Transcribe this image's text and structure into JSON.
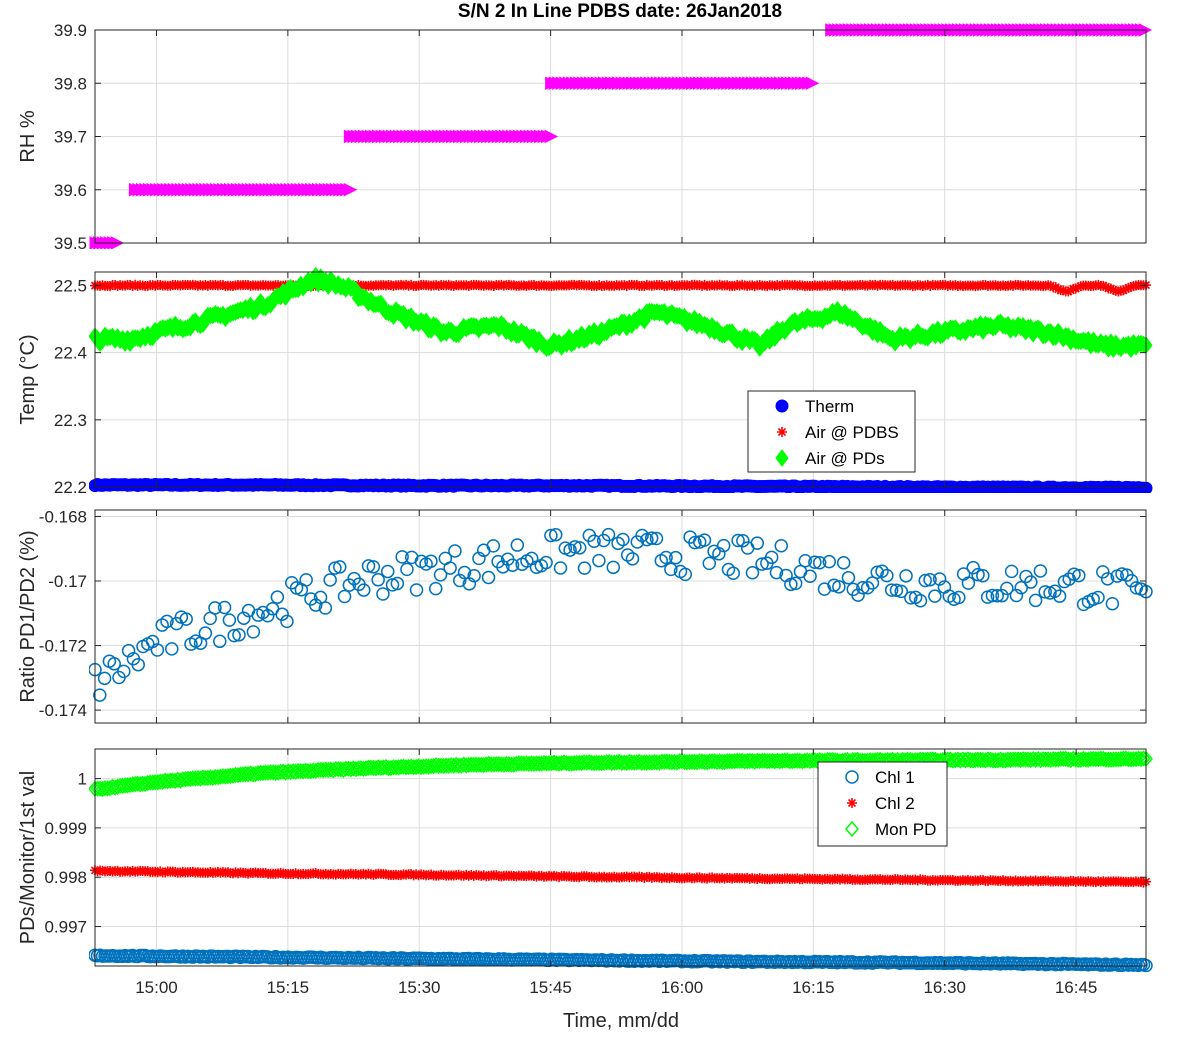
{
  "figure": {
    "title": "S/N 2 In Line PDBS date: 26Jan2018",
    "xlabel": "Time, mm/dd"
  },
  "chart_data": [
    {
      "type": "scatter",
      "ylabel": "RH %",
      "xlim": [
        14.883,
        16.883
      ],
      "ylim": [
        39.5,
        39.9
      ],
      "xticks": [
        15.0,
        15.25,
        15.5,
        15.75,
        16.0,
        16.25,
        16.5,
        16.75
      ],
      "xticklabels": [
        "15:00",
        "15:15",
        "15:30",
        "15:45",
        "16:00",
        "16:15",
        "16:30",
        "16:45"
      ],
      "yticks": [
        39.5,
        39.6,
        39.7,
        39.8,
        39.9
      ],
      "yticklabels": [
        "39.5",
        "39.6",
        "39.7",
        "39.8",
        "39.9"
      ],
      "grid": true,
      "series": [
        {
          "marker": "triangle-right",
          "color": "#ff00ff",
          "segments": [
            {
              "y": 39.5,
              "x": [
                14.883,
                14.925
              ]
            },
            {
              "y": 39.6,
              "x": [
                14.958,
                15.367
              ]
            },
            {
              "y": 39.7,
              "x": [
                15.367,
                15.75
              ]
            },
            {
              "y": 39.8,
              "x": [
                15.75,
                16.25
              ]
            },
            {
              "y": 39.9,
              "x": [
                16.283,
                16.883
              ]
            }
          ]
        }
      ]
    },
    {
      "type": "scatter",
      "ylabel": "Temp (°C)",
      "xlim": [
        14.883,
        16.883
      ],
      "ylim": [
        22.2,
        22.52
      ],
      "xticks": [
        15.0,
        15.25,
        15.5,
        15.75,
        16.0,
        16.25,
        16.5,
        16.75
      ],
      "yticks": [
        22.2,
        22.3,
        22.4,
        22.5
      ],
      "yticklabels": [
        "22.2",
        "22.3",
        "22.4",
        "22.5"
      ],
      "grid": true,
      "legend_position": "center-right",
      "series": [
        {
          "name": "Therm",
          "marker": "filled-circle",
          "color": "#0000ff",
          "trend": {
            "x": [
              14.883,
              15.2,
              15.5,
              15.8,
              16.1,
              16.4,
              16.7,
              16.883
            ],
            "y": [
              22.203,
              22.203,
              22.202,
              22.202,
              22.201,
              22.2,
              22.199,
              22.199
            ]
          }
        },
        {
          "name": "Air @ PDBS",
          "marker": "asterisk",
          "color": "#ff0000",
          "trend": {
            "x": [
              14.883,
              16.5,
              16.7,
              16.733,
              16.76,
              16.8,
              16.83,
              16.86,
              16.883
            ],
            "y": [
              22.5,
              22.5,
              22.5,
              22.49,
              22.5,
              22.5,
              22.49,
              22.5,
              22.5
            ]
          }
        },
        {
          "name": "Air @ PDs",
          "marker": "filled-diamond",
          "color": "#00ff00",
          "trend": {
            "x": [
              14.883,
              14.95,
              15.0,
              15.1,
              15.2,
              15.3,
              15.35,
              15.45,
              15.55,
              15.65,
              15.75,
              15.85,
              15.95,
              16.05,
              16.15,
              16.2,
              16.3,
              16.4,
              16.5,
              16.6,
              16.7,
              16.8,
              16.883
            ],
            "y": [
              22.42,
              22.42,
              22.43,
              22.45,
              22.47,
              22.51,
              22.5,
              22.46,
              22.43,
              22.44,
              22.41,
              22.43,
              22.46,
              22.44,
              22.41,
              22.44,
              22.46,
              22.42,
              22.43,
              22.44,
              22.43,
              22.41,
              22.41
            ]
          }
        }
      ]
    },
    {
      "type": "scatter",
      "ylabel": "Ratio PD1/PD2 (%)",
      "xlim": [
        14.883,
        16.883
      ],
      "ylim": [
        -0.1744,
        -0.1678
      ],
      "xticks": [
        15.0,
        15.25,
        15.5,
        15.75,
        16.0,
        16.25,
        16.5,
        16.75
      ],
      "yticks": [
        -0.174,
        -0.172,
        -0.17,
        -0.168
      ],
      "yticklabels": [
        "-0.174",
        "-0.172",
        "-0.17",
        "-0.168"
      ],
      "grid": true,
      "series": [
        {
          "name": "Ratio PD1/PD2",
          "marker": "open-circle",
          "color": "#0072bd",
          "trend": {
            "x": [
              14.883,
              14.95,
              15.0,
              15.1,
              15.2,
              15.3,
              15.4,
              15.5,
              15.6,
              15.7,
              15.8,
              15.9,
              16.0,
              16.1,
              16.2,
              16.3,
              16.4,
              16.5,
              16.6,
              16.7,
              16.8,
              16.883
            ],
            "y": [
              -0.1732,
              -0.1725,
              -0.1719,
              -0.1714,
              -0.1709,
              -0.1704,
              -0.1699,
              -0.1697,
              -0.1695,
              -0.1692,
              -0.1691,
              -0.1691,
              -0.1692,
              -0.1693,
              -0.1695,
              -0.1698,
              -0.17,
              -0.1701,
              -0.1701,
              -0.1701,
              -0.1702,
              -0.1705
            ]
          },
          "noise": 0.0006
        }
      ]
    },
    {
      "type": "scatter",
      "ylabel": "PDs/Monitor/1st val",
      "xlim": [
        14.883,
        16.883
      ],
      "ylim": [
        0.9962,
        1.0006
      ],
      "xticks": [
        15.0,
        15.25,
        15.5,
        15.75,
        16.0,
        16.25,
        16.5,
        16.75
      ],
      "xticklabels": [
        "15:00",
        "15:15",
        "15:30",
        "15:45",
        "16:00",
        "16:15",
        "16:30",
        "16:45"
      ],
      "yticks": [
        0.997,
        0.998,
        0.999,
        1.0
      ],
      "yticklabels": [
        "0.997",
        "0.998",
        "0.999",
        "1"
      ],
      "grid": true,
      "legend_position": "top-right",
      "series": [
        {
          "name": "Chl 1",
          "marker": "open-circle",
          "color": "#0072bd",
          "trend": {
            "x": [
              14.883,
              15.2,
              15.5,
              15.8,
              16.1,
              16.4,
              16.7,
              16.883
            ],
            "y": [
              0.99641,
              0.99638,
              0.99635,
              0.99632,
              0.99629,
              0.99627,
              0.99624,
              0.99622
            ]
          }
        },
        {
          "name": "Chl 2",
          "marker": "asterisk",
          "color": "#ff0000",
          "trend": {
            "x": [
              14.883,
              15.2,
              15.5,
              15.8,
              16.1,
              16.4,
              16.7,
              16.883
            ],
            "y": [
              0.99813,
              0.99808,
              0.99805,
              0.99801,
              0.99798,
              0.99795,
              0.99792,
              0.9979
            ]
          }
        },
        {
          "name": "Mon PD",
          "marker": "open-diamond",
          "color": "#00ff00",
          "trend": {
            "x": [
              14.883,
              15.0,
              15.2,
              15.4,
              15.6,
              15.8,
              16.0,
              16.2,
              16.4,
              16.6,
              16.883
            ],
            "y": [
              0.99978,
              0.99993,
              1.00011,
              1.00021,
              1.00028,
              1.00032,
              1.00034,
              1.00036,
              1.00037,
              1.00038,
              1.0004
            ]
          }
        }
      ]
    }
  ]
}
